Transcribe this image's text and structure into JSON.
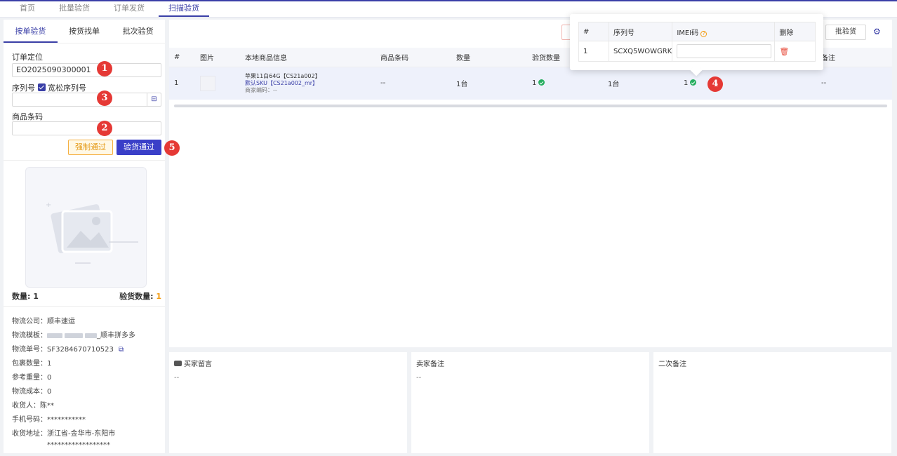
{
  "top_tabs": [
    "首页",
    "批量验货",
    "订单发货",
    "扫描验货"
  ],
  "left": {
    "sub_tabs": [
      "按单验货",
      "按货找单",
      "批次验货"
    ],
    "order_label": "订单定位",
    "order_value": "EO2025090300001",
    "serial_label": "序列号",
    "loose_label": "宽松序列号",
    "barcode_label": "商品条码",
    "force_btn": "强制通过",
    "pass_btn": "验货通过",
    "qty_label": "数量: 1",
    "inspected_label": "验货数量:",
    "inspected_value": "1",
    "info": {
      "carrier": "物流公司：顺丰速运",
      "template_prefix": "物流模板：",
      "template_suffix": "_顺丰拼多多",
      "tracking": "物流单号：SF3284670710523",
      "packages": "包裹数量：1",
      "weight": "参考重量：0",
      "cost": "物流成本：0",
      "receiver": "收货人：陈**",
      "phone": "手机号码：***********",
      "address": "收货地址：浙江省-金华市-东阳市",
      "address_detail": "******************"
    }
  },
  "badges": [
    "1",
    "2",
    "3",
    "4",
    "5"
  ],
  "main": {
    "batch_btn": "批验货",
    "columns": [
      "#",
      "图片",
      "本地商品信息",
      "商品条码",
      "数量",
      "验货数量",
      "",
      "",
      "",
      "备注"
    ],
    "row": {
      "index": "1",
      "product_name": "苹果11白64G【CS21a002】",
      "sku": "默认SKU【CS21a002_mr】",
      "merchant_code": "商家编码：--",
      "barcode": "--",
      "qty": "1台",
      "inspected": "1",
      "col7": "1台",
      "col8": "1",
      "remark": "--"
    }
  },
  "popup": {
    "headers": [
      "#",
      "序列号",
      "IMEI码",
      "删除"
    ],
    "row": {
      "index": "1",
      "serial": "SCXQ5WOWGRK",
      "imei": ""
    }
  },
  "panels": [
    {
      "title": "买家留言",
      "body": "--"
    },
    {
      "title": "卖家备注",
      "body": "--"
    },
    {
      "title": "二次备注",
      "body": ""
    }
  ]
}
